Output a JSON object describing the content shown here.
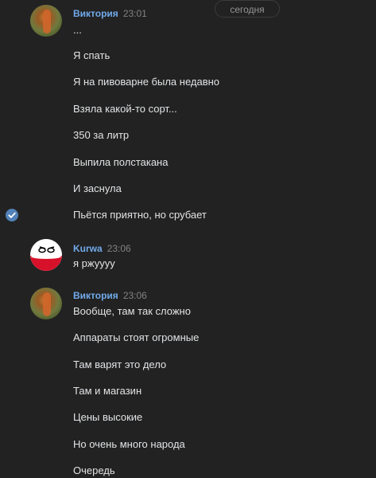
{
  "date_divider": "сегодня",
  "groups": [
    {
      "author": "Виктория",
      "time": "23:01",
      "avatar_icon": "user-photo-avatar",
      "lines": [
        "...",
        "Я спать",
        "Я на пивоварне была недавно",
        "Взяла какой-то сорт...",
        "350 за литр",
        "Выпила полстакана",
        "И заснула",
        "Пьётся приятно, но срубает"
      ]
    },
    {
      "author": "Kurwa",
      "time": "23:06",
      "avatar_icon": "polandball-avatar",
      "lines": [
        "я ржуууу"
      ]
    },
    {
      "author": "Виктория",
      "time": "23:06",
      "avatar_icon": "user-photo-avatar",
      "lines": [
        "Вообще, там так сложно",
        "Аппараты стоят огромные",
        "Там варят это дело",
        "Там и магазин",
        "Цены высокие",
        "Но очень много народа",
        "Очередь"
      ]
    }
  ],
  "colors": {
    "background": "#222222",
    "author_name": "#71aaeb",
    "text": "#e1e3e6",
    "timestamp": "#828282",
    "selected_check": "#5181b8"
  }
}
